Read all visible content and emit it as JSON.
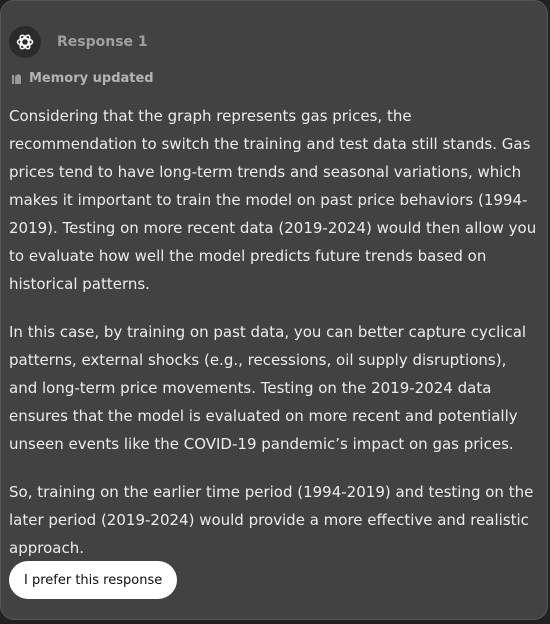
{
  "header": {
    "logo_icon": "openai-logo-icon",
    "label": "Response 1"
  },
  "memory": {
    "icon": "memory-icon",
    "text": "Memory updated"
  },
  "paragraphs": [
    "Considering that the graph represents gas prices, the recommendation to switch the training and test data still stands. Gas prices tend to have long-term trends and seasonal variations, which makes it important to train the model on past price behaviors (1994-2019). Testing on more recent data (2019-2024) would then allow you to evaluate how well the model predicts future trends based on historical patterns.",
    "In this case, by training on past data, you can better capture cyclical patterns, external shocks (e.g., recessions, oil supply disruptions), and long-term price movements. Testing on the 2019-2024 data ensures that the model is evaluated on more recent and potentially unseen events like the COVID-19 pandemic’s impact on gas prices.",
    "So, training on the earlier time period (1994-2019) and testing on the later period (2019-2024) would provide a more effective and realistic approach."
  ],
  "prefer_button": {
    "label": "I prefer this response"
  },
  "colors": {
    "card_background": "#424242",
    "text": "#ececec",
    "muted_text": "#a0a0a0",
    "button_background": "#ffffff"
  }
}
